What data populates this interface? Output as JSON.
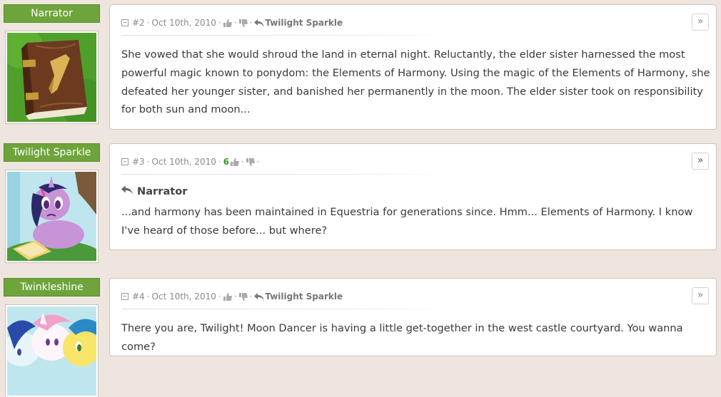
{
  "posts": [
    {
      "author": "Narrator",
      "number": "#2",
      "date": "Oct 10th, 2010",
      "score": "",
      "reply_to": "Twilight Sparkle",
      "body": "She vowed that she would shroud the land in eternal night. Reluctantly, the elder sister harnessed the most powerful magic known to ponydom: the Elements of Harmony. Using the magic of the Elements of Harmony, she defeated her younger sister, and banished her permanently in the moon. The elder sister took on responsibility for both sun and moon...",
      "goto": "»"
    },
    {
      "author": "Twilight Sparkle",
      "number": "#3",
      "date": "Oct 10th, 2010",
      "score": "6",
      "quote_author": "Narrator",
      "body": "...and harmony has been maintained in Equestria for generations since. Hmm... Elements of Harmony. I know I've heard of those before... but where?",
      "goto": "»"
    },
    {
      "author": "Twinkleshine",
      "number": "#4",
      "date": "Oct 10th, 2010",
      "score": "",
      "reply_to": "Twilight Sparkle",
      "body": "There you are, Twilight! Moon Dancer is having a little get-together in the west castle courtyard. You wanna come?",
      "goto": "»"
    }
  ],
  "icons": {
    "collapse": "collapse-icon",
    "thumbs_up": "thumbs-up-icon",
    "thumbs_down": "thumbs-down-icon",
    "reply": "reply-arrow-icon",
    "goto": "goto-post-icon"
  },
  "colors": {
    "page_bg": "#efe5df",
    "name_tag": "#6ea43b",
    "score": "#3a9a2a"
  },
  "separator": "·"
}
